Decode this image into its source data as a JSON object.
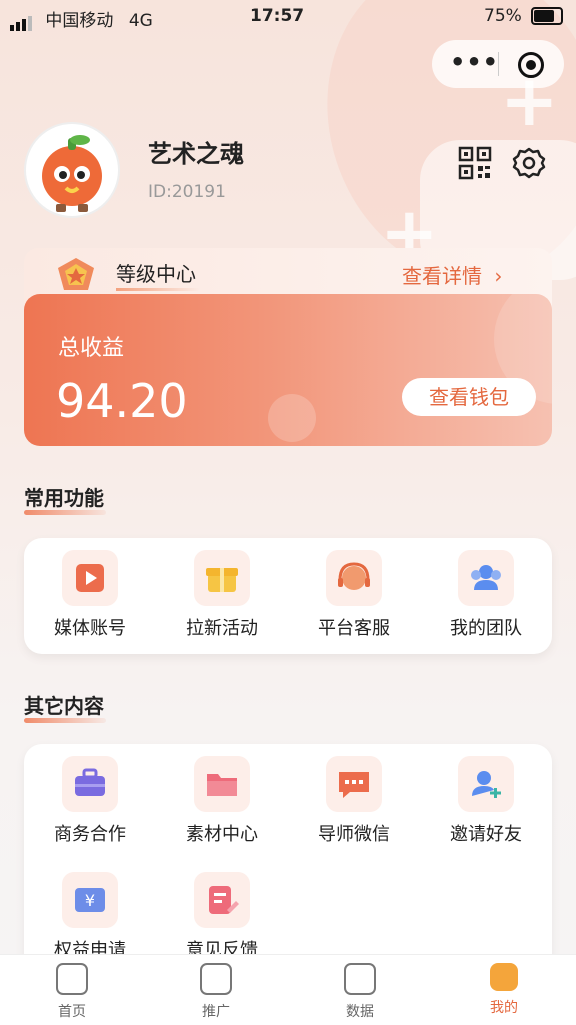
{
  "status_bar": {
    "carrier": "中国移动",
    "network": "4G",
    "time": "17:57",
    "battery": "75%"
  },
  "capsule": {
    "menu_icon": "more-dots-icon",
    "close_icon": "target-circle-icon"
  },
  "profile": {
    "name": "艺术之魂",
    "id": "ID:20191",
    "qr_icon": "qr-code-icon",
    "settings_icon": "gear-icon"
  },
  "level": {
    "title": "等级中心",
    "more": "查看详情"
  },
  "earnings": {
    "label": "总收益",
    "amount": "94.20",
    "wallet_button": "查看钱包"
  },
  "common": {
    "title": "常用功能",
    "items": [
      {
        "label": "媒体账号",
        "icon": "video-icon"
      },
      {
        "label": "拉新活动",
        "icon": "gift-icon"
      },
      {
        "label": "平台客服",
        "icon": "headset-icon"
      },
      {
        "label": "我的团队",
        "icon": "team-icon"
      }
    ]
  },
  "other": {
    "title": "其它内容",
    "items": [
      {
        "label": "商务合作",
        "icon": "briefcase-icon"
      },
      {
        "label": "素材中心",
        "icon": "folder-icon"
      },
      {
        "label": "导师微信",
        "icon": "chat-icon"
      },
      {
        "label": "邀请好友",
        "icon": "add-user-icon"
      },
      {
        "label": "权益申请",
        "icon": "ticket-icon"
      },
      {
        "label": "意见反馈",
        "icon": "feedback-icon"
      }
    ]
  },
  "tabbar": {
    "tabs": [
      {
        "label": "首页",
        "icon": "home-icon"
      },
      {
        "label": "推广",
        "icon": "share-icon"
      },
      {
        "label": "数据",
        "icon": "chart-icon"
      },
      {
        "label": "我的",
        "icon": "profile-icon"
      }
    ]
  },
  "colors": {
    "accent": "#e4683f",
    "card_gradient_start": "#ee7552"
  }
}
